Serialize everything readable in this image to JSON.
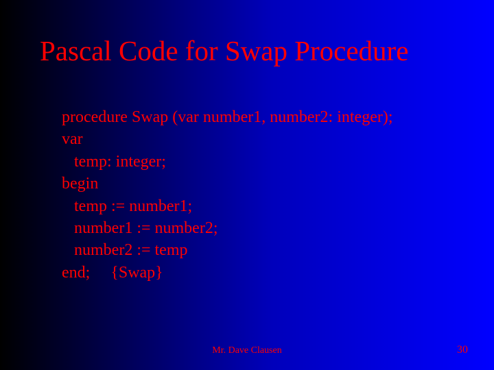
{
  "title": "Pascal Code for Swap Procedure",
  "code": {
    "l1": "procedure Swap (var number1, number2: integer);",
    "l2": "var",
    "l3": "temp: integer;",
    "l4": "begin",
    "l5": "temp := number1;",
    "l6": "number1 := number2;",
    "l7": "number2 := temp",
    "l8": "end;     {Swap}"
  },
  "footer": {
    "author": "Mr. Dave Clausen",
    "page": "30"
  }
}
